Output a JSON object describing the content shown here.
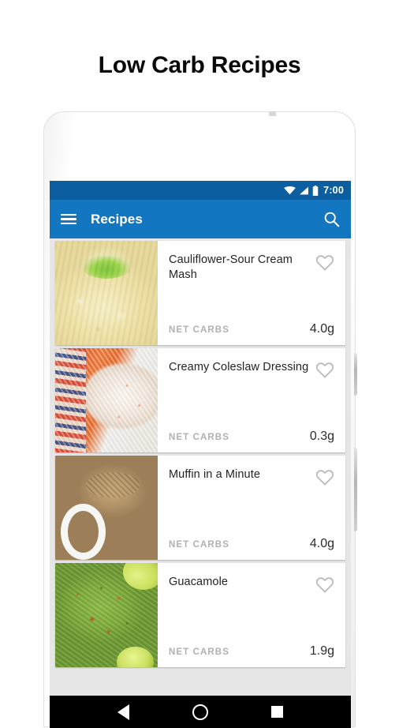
{
  "page": {
    "title": "Low Carb Recipes",
    "background_color": "#ffffff",
    "title_color": "#0a0a0a"
  },
  "device": {
    "frame_color": "#fbfbfb",
    "elements": [
      "front-camera",
      "speaker-grille",
      "earpiece",
      "volume-button",
      "power-button"
    ]
  },
  "statusbar": {
    "clock": "7:00",
    "background_color": "#0b5fa0",
    "icons": [
      "wifi-icon",
      "signal-icon",
      "battery-icon"
    ]
  },
  "appbar": {
    "title": "Recipes",
    "background_color": "#1376c0",
    "menu_icon": "hamburger-menu-icon",
    "search_icon": "search-icon"
  },
  "list": {
    "net_carbs_label": "NET CARBS",
    "favorite_icon": "heart-outline-icon",
    "items": [
      {
        "name": "Cauliflower-Sour Cream Mash",
        "net_carbs": "4.0g",
        "image": "cauliflower-mash-photo",
        "favorited": false
      },
      {
        "name": "Creamy Coleslaw Dressing",
        "net_carbs": "0.3g",
        "image": "coleslaw-bowl-photo",
        "favorited": false
      },
      {
        "name": "Muffin in a Minute",
        "net_carbs": "4.0g",
        "image": "mug-muffin-photo",
        "favorited": false
      },
      {
        "name": "Guacamole",
        "net_carbs": "1.9g",
        "image": "guacamole-bowl-photo",
        "favorited": false
      }
    ]
  },
  "navbar": {
    "background_color": "#000000",
    "buttons": [
      "back-icon",
      "home-icon",
      "recents-icon"
    ]
  }
}
